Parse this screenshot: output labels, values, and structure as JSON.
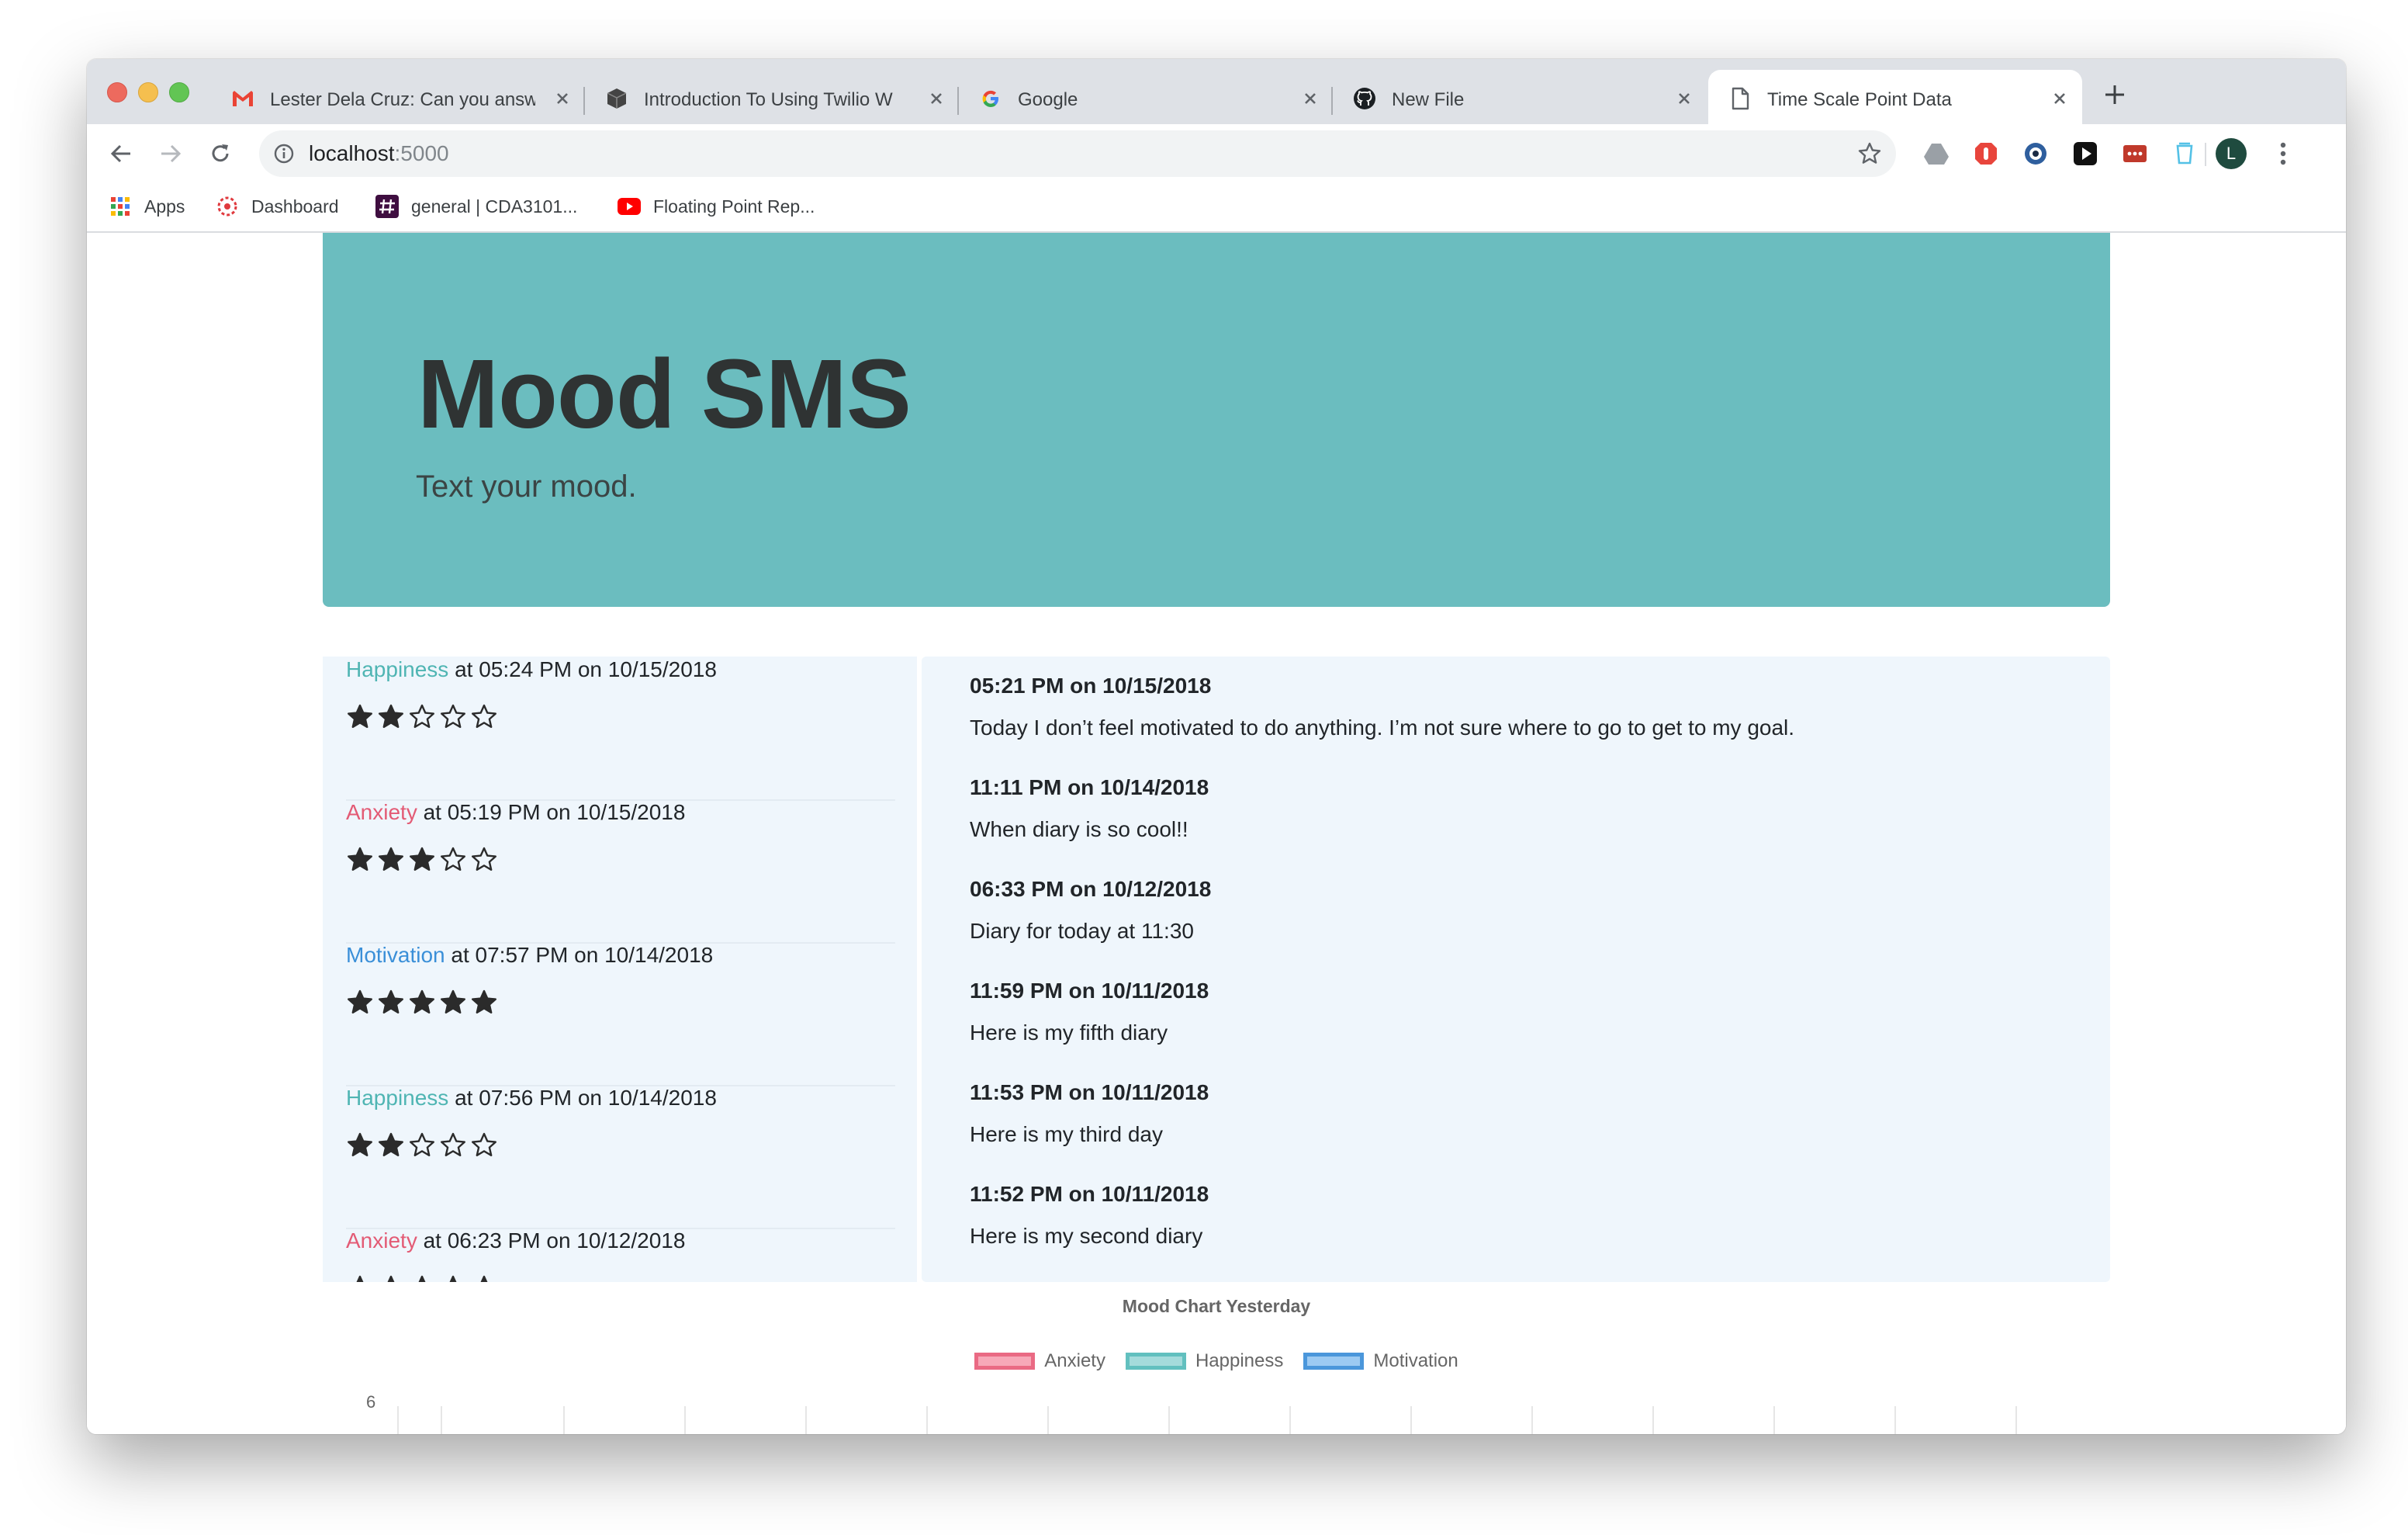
{
  "browser": {
    "tabs": [
      {
        "title": "Lester Dela Cruz: Can you answ",
        "icon": "gmail-icon"
      },
      {
        "title": "Introduction To Using Twilio W",
        "icon": "cube-icon"
      },
      {
        "title": "Google",
        "icon": "google-icon"
      },
      {
        "title": "New File",
        "icon": "github-icon"
      },
      {
        "title": "Time Scale Point Data",
        "icon": "file-icon"
      }
    ],
    "url_host": "localhost",
    "url_port": ":5000",
    "avatar_letter": "L",
    "bookmarks": [
      {
        "label": "Apps"
      },
      {
        "label": "Dashboard"
      },
      {
        "label": "general | CDA3101..."
      },
      {
        "label": "Floating Point Rep..."
      }
    ]
  },
  "header": {
    "title": "Mood SMS",
    "subtitle": "Text your mood."
  },
  "moods": [
    {
      "type": "Happiness",
      "color": "#4fb5b3",
      "rest": " at 05:24 PM on 10/15/2018",
      "rating": 2
    },
    {
      "type": "Anxiety",
      "color": "#e35b75",
      "rest": " at 05:19 PM on 10/15/2018",
      "rating": 3
    },
    {
      "type": "Motivation",
      "color": "#3a8fd8",
      "rest": " at 07:57 PM on 10/14/2018",
      "rating": 5
    },
    {
      "type": "Happiness",
      "color": "#4fb5b3",
      "rest": " at 07:56 PM on 10/14/2018",
      "rating": 2
    },
    {
      "type": "Anxiety",
      "color": "#e35b75",
      "rest": " at 06:23 PM on 10/12/2018",
      "rating": 5
    }
  ],
  "diary": [
    {
      "date": "05:21 PM on 10/15/2018",
      "text": "Today I don’t feel motivated to do anything. I’m not sure where to go to get to my goal."
    },
    {
      "date": "11:11 PM on 10/14/2018",
      "text": "When diary is so cool!!"
    },
    {
      "date": "06:33 PM on 10/12/2018",
      "text": "Diary for today at 11:30"
    },
    {
      "date": "11:59 PM on 10/11/2018",
      "text": "Here is my fifth diary"
    },
    {
      "date": "11:53 PM on 10/11/2018",
      "text": "Here is my third day"
    },
    {
      "date": "11:52 PM on 10/11/2018",
      "text": "Here is my second diary"
    }
  ],
  "chart": {
    "title": "Mood Chart Yesterday",
    "y_top_tick": "6",
    "legend": [
      {
        "label": "Anxiety",
        "fill": "#f7a8b8",
        "border": "#ea6a84"
      },
      {
        "label": "Happiness",
        "fill": "#a4dbdb",
        "border": "#62c0bf"
      },
      {
        "label": "Motivation",
        "fill": "#9ccaf2",
        "border": "#4b97db"
      }
    ]
  }
}
